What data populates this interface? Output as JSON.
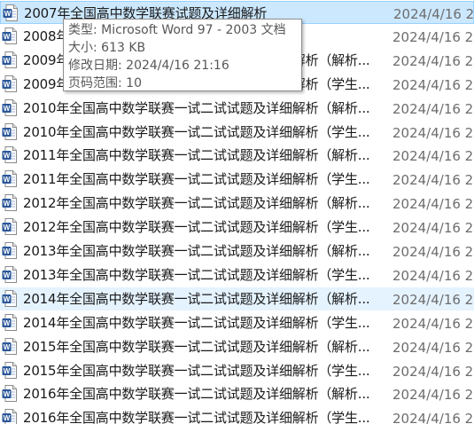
{
  "files": [
    {
      "name": "2007年全国高中数学联赛试题及详细解析",
      "date": "2024/4/16 2",
      "state": "selected"
    },
    {
      "name": "2008年全国高中数学联赛试题及详细解析",
      "date": "2024/4/16 2",
      "state": ""
    },
    {
      "name": "2009年全国高中数学联赛一试二试试题及详细解析（解析...",
      "date": "2024/4/16 2",
      "state": ""
    },
    {
      "name": "2009年全国高中数学联赛一试二试试题及详细解析（学生...",
      "date": "2024/4/16 2",
      "state": ""
    },
    {
      "name": "2010年全国高中数学联赛一试二试试题及详细解析（解析...",
      "date": "2024/4/16 2",
      "state": ""
    },
    {
      "name": "2010年全国高中数学联赛一试二试试题及详细解析（学生...",
      "date": "2024/4/16 2",
      "state": ""
    },
    {
      "name": "2011年全国高中数学联赛一试二试试题及详细解析（解析...",
      "date": "2024/4/16 2",
      "state": ""
    },
    {
      "name": "2011年全国高中数学联赛一试二试试题及详细解析（学生...",
      "date": "2024/4/16 2",
      "state": ""
    },
    {
      "name": "2012年全国高中数学联赛一试二试试题及详细解析（解析...",
      "date": "2024/4/16 2",
      "state": ""
    },
    {
      "name": "2012年全国高中数学联赛一试二试试题及详细解析（学生...",
      "date": "2024/4/16 2",
      "state": ""
    },
    {
      "name": "2013年全国高中数学联赛一试二试试题及详细解析（解析...",
      "date": "2024/4/16 2",
      "state": ""
    },
    {
      "name": "2013年全国高中数学联赛一试二试试题及详细解析（学生...",
      "date": "2024/4/16 2",
      "state": ""
    },
    {
      "name": "2014年全国高中数学联赛一试二试试题及详细解析（解析...",
      "date": "2024/4/16 2",
      "state": "hover"
    },
    {
      "name": "2014年全国高中数学联赛一试二试试题及详细解析（学生...",
      "date": "2024/4/16 2",
      "state": ""
    },
    {
      "name": "2015年全国高中数学联赛一试二试试题及详细解析（解析...",
      "date": "2024/4/16 2",
      "state": ""
    },
    {
      "name": "2015年全国高中数学联赛一试二试试题及详细解析（学生...",
      "date": "2024/4/16 2",
      "state": ""
    },
    {
      "name": "2016年全国高中数学联赛一试二试试题及详细解析（解析...",
      "date": "2024/4/16 2",
      "state": ""
    },
    {
      "name": "2016年全国高中数学联赛一试二试试题及详细解析（学生...",
      "date": "2024/4/16 2",
      "state": ""
    }
  ],
  "tooltip": {
    "type_line": "类型: Microsoft Word 97 - 2003 文档",
    "size_line": "大小: 613 KB",
    "modified_line": "修改日期: 2024/4/16 21:16",
    "pages_line": "页码范围: 10"
  },
  "colors": {
    "selected_bg": "#cce8ff",
    "selected_border": "#99d1ff",
    "hover_bg": "#e5f3ff",
    "word_blue": "#2b579a"
  },
  "icons": {
    "file_icon": "word-document-icon"
  }
}
